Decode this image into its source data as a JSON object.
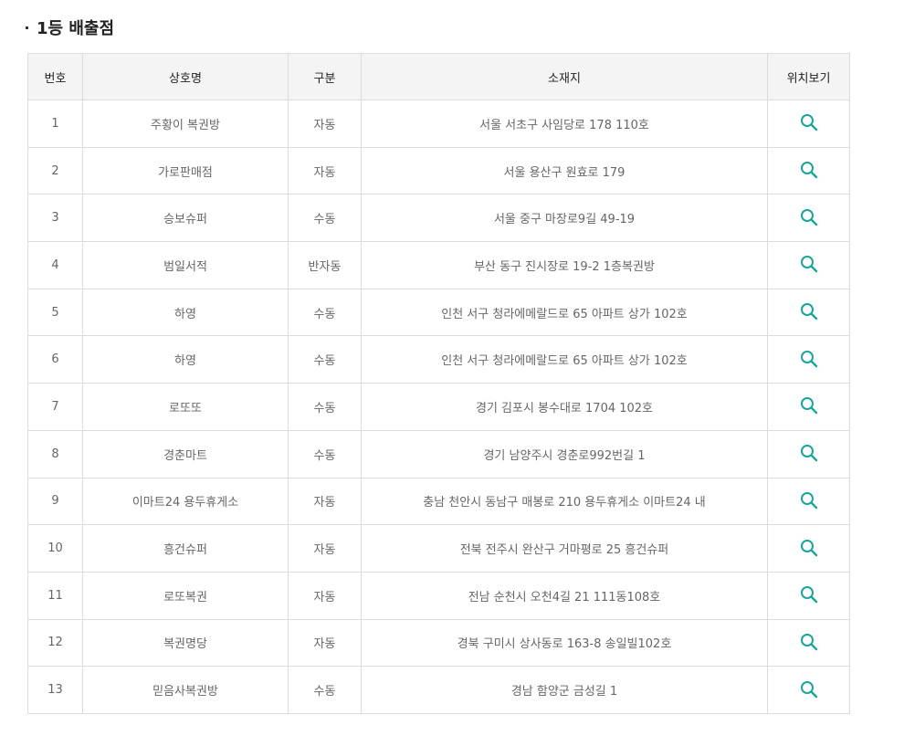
{
  "title": "1등 배출점",
  "headers": {
    "no": "번호",
    "name": "상호명",
    "type": "구분",
    "address": "소재지",
    "map": "위치보기"
  },
  "accent_color": "#1aa59a",
  "map_icon": "search-icon",
  "rows": [
    {
      "no": "1",
      "name": "주황이 복권방",
      "type": "자동",
      "address": "서울 서초구 사임당로 178 110호"
    },
    {
      "no": "2",
      "name": "가로판매점",
      "type": "자동",
      "address": "서울 용산구 원효로 179"
    },
    {
      "no": "3",
      "name": "승보슈퍼",
      "type": "수동",
      "address": "서울 중구 마장로9길 49-19"
    },
    {
      "no": "4",
      "name": "범일서적",
      "type": "반자동",
      "address": "부산 동구 진시장로 19-2 1층복권방"
    },
    {
      "no": "5",
      "name": "하영",
      "type": "수동",
      "address": "인천 서구 청라에메랄드로 65 아파트 상가 102호"
    },
    {
      "no": "6",
      "name": "하영",
      "type": "수동",
      "address": "인천 서구 청라에메랄드로 65 아파트 상가 102호"
    },
    {
      "no": "7",
      "name": "로또또",
      "type": "수동",
      "address": "경기 김포시 봉수대로 1704 102호"
    },
    {
      "no": "8",
      "name": "경춘마트",
      "type": "수동",
      "address": "경기 남양주시 경춘로992번길 1"
    },
    {
      "no": "9",
      "name": "이마트24 용두휴게소",
      "type": "자동",
      "address": "충남 천안시 동남구 매봉로 210 용두휴게소 이마트24 내"
    },
    {
      "no": "10",
      "name": "흥건슈퍼",
      "type": "자동",
      "address": "전북 전주시 완산구 거마평로 25 흥건슈퍼"
    },
    {
      "no": "11",
      "name": "로또복권",
      "type": "자동",
      "address": "전남 순천시 오천4길 21 111동108호"
    },
    {
      "no": "12",
      "name": "복권명당",
      "type": "자동",
      "address": "경북 구미시 상사동로 163-8 송일빌102호"
    },
    {
      "no": "13",
      "name": "믿음사복권방",
      "type": "수동",
      "address": "경남 함양군 금성길 1"
    }
  ]
}
